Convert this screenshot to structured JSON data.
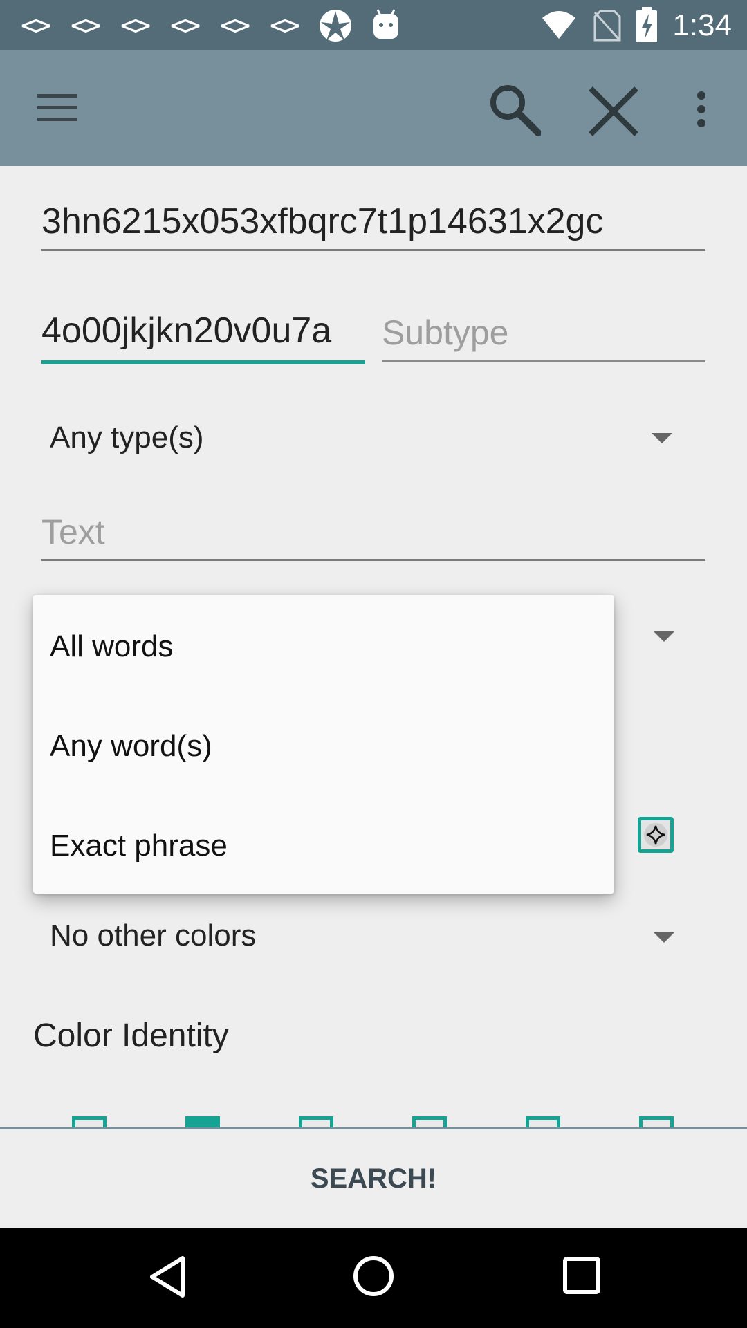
{
  "status_bar": {
    "notification_icons": [
      "code-icon",
      "code-icon",
      "code-icon",
      "code-icon",
      "code-icon",
      "code-icon",
      "star-app-icon",
      "android-icon"
    ],
    "time": "1:34",
    "icons": [
      "wifi-icon",
      "no-sim-icon",
      "battery-charging-icon"
    ]
  },
  "app_bar": {
    "menu_icon": "hamburger-menu-icon",
    "actions": [
      "search-icon",
      "close-icon",
      "overflow-menu-icon"
    ]
  },
  "form": {
    "name_value": "3hn6215x053xfbqrc7t1p14631x2gc",
    "type_value": "4o00jkjkn20v0u7a",
    "subtype_placeholder": "Subtype",
    "type_spinner": "Any type(s)",
    "text_placeholder": "Text",
    "other_colors_spinner": "No other colors",
    "color_identity_heading": "Color Identity"
  },
  "dropdown_popup": {
    "options": [
      "All words",
      "Any word(s)",
      "Exact phrase"
    ]
  },
  "colors": {
    "status_bar": "#536c78",
    "app_bar": "#78909c",
    "accent": "#16a394"
  },
  "bottom": {
    "search_button": "SEARCH!"
  },
  "nav_bar": [
    "back-icon",
    "home-icon",
    "recents-icon"
  ]
}
